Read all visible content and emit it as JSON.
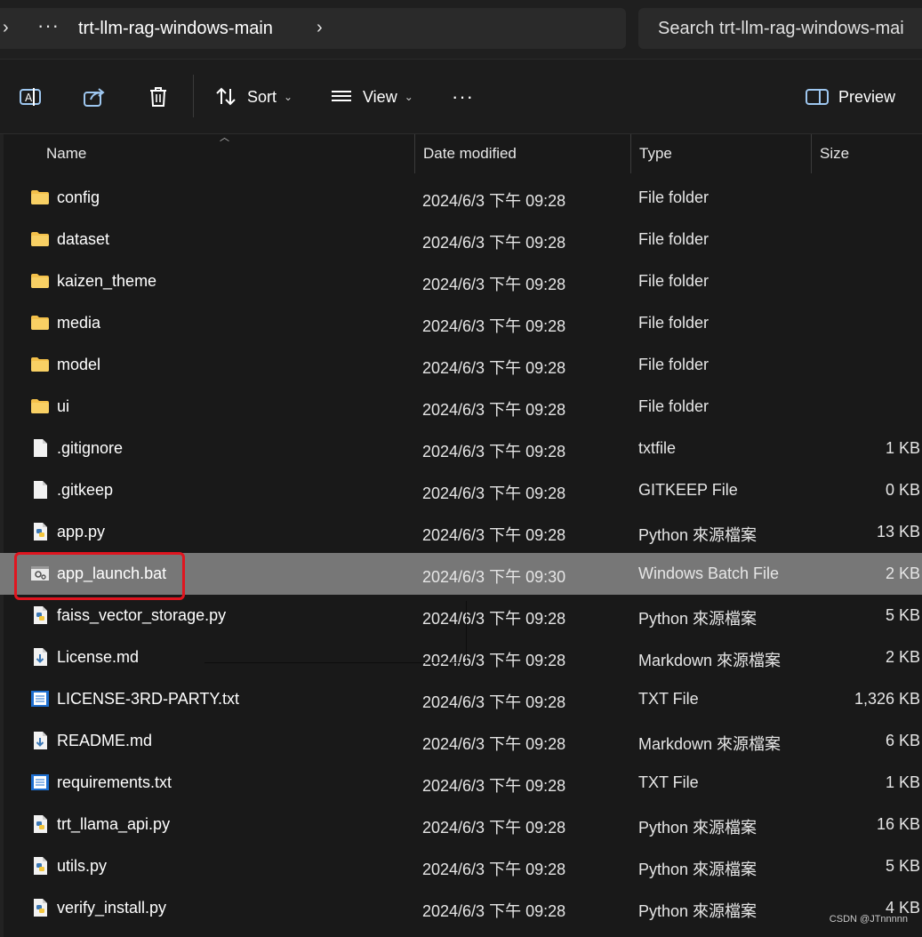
{
  "address": {
    "more": "···",
    "crumb": "trt-llm-rag-windows-main",
    "search_placeholder": "Search trt-llm-rag-windows-mai"
  },
  "toolbar": {
    "sort_label": "Sort",
    "view_label": "View",
    "more_label": "···",
    "preview_label": "Preview"
  },
  "columns": {
    "name": "Name",
    "date": "Date modified",
    "type": "Type",
    "size": "Size"
  },
  "files": [
    {
      "name": "config",
      "date": "2024/6/3 下午 09:28",
      "type": "File folder",
      "size": "",
      "icon": "folder-icon"
    },
    {
      "name": "dataset",
      "date": "2024/6/3 下午 09:28",
      "type": "File folder",
      "size": "",
      "icon": "folder-icon"
    },
    {
      "name": "kaizen_theme",
      "date": "2024/6/3 下午 09:28",
      "type": "File folder",
      "size": "",
      "icon": "folder-icon"
    },
    {
      "name": "media",
      "date": "2024/6/3 下午 09:28",
      "type": "File folder",
      "size": "",
      "icon": "folder-icon"
    },
    {
      "name": "model",
      "date": "2024/6/3 下午 09:28",
      "type": "File folder",
      "size": "",
      "icon": "folder-icon"
    },
    {
      "name": "ui",
      "date": "2024/6/3 下午 09:28",
      "type": "File folder",
      "size": "",
      "icon": "folder-icon"
    },
    {
      "name": ".gitignore",
      "date": "2024/6/3 下午 09:28",
      "type": "txtfile",
      "size": "1 KB",
      "icon": "blank-file-icon"
    },
    {
      "name": ".gitkeep",
      "date": "2024/6/3 下午 09:28",
      "type": "GITKEEP File",
      "size": "0 KB",
      "icon": "blank-file-icon"
    },
    {
      "name": "app.py",
      "date": "2024/6/3 下午 09:28",
      "type": "Python 來源檔案",
      "size": "13 KB",
      "icon": "python-file-icon"
    },
    {
      "name": "app_launch.bat",
      "date": "2024/6/3 下午 09:30",
      "type": "Windows Batch File",
      "size": "2 KB",
      "icon": "batch-file-icon",
      "selected": true
    },
    {
      "name": "faiss_vector_storage.py",
      "date": "2024/6/3 下午 09:28",
      "type": "Python 來源檔案",
      "size": "5 KB",
      "icon": "python-file-icon"
    },
    {
      "name": "License.md",
      "date": "2024/6/3 下午 09:28",
      "type": "Markdown 來源檔案",
      "size": "2 KB",
      "icon": "markdown-file-icon"
    },
    {
      "name": "LICENSE-3RD-PARTY.txt",
      "date": "2024/6/3 下午 09:28",
      "type": "TXT File",
      "size": "1,326 KB",
      "icon": "text-file-icon"
    },
    {
      "name": "README.md",
      "date": "2024/6/3 下午 09:28",
      "type": "Markdown 來源檔案",
      "size": "6 KB",
      "icon": "markdown-file-icon"
    },
    {
      "name": "requirements.txt",
      "date": "2024/6/3 下午 09:28",
      "type": "TXT File",
      "size": "1 KB",
      "icon": "text-file-icon"
    },
    {
      "name": "trt_llama_api.py",
      "date": "2024/6/3 下午 09:28",
      "type": "Python 來源檔案",
      "size": "16 KB",
      "icon": "python-file-icon"
    },
    {
      "name": "utils.py",
      "date": "2024/6/3 下午 09:28",
      "type": "Python 來源檔案",
      "size": "5 KB",
      "icon": "python-file-icon"
    },
    {
      "name": "verify_install.py",
      "date": "2024/6/3 下午 09:28",
      "type": "Python 來源檔案",
      "size": "4 KB",
      "icon": "python-file-icon"
    }
  ],
  "watermark": "CSDN @JTnnnnn",
  "colors": {
    "selection": "#777777",
    "highlight_box": "#e0151f",
    "folder": "#f3c04a",
    "python_blue": "#3b77b5",
    "text_file_blue": "#1e6fd0"
  }
}
